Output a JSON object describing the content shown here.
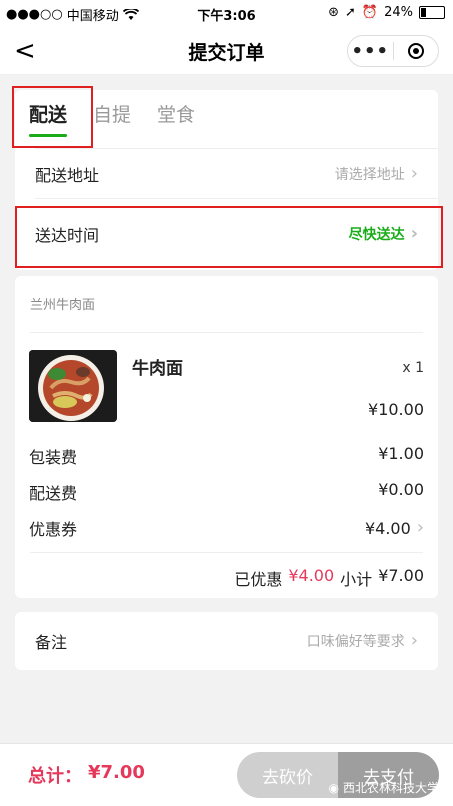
{
  "status_bar": {
    "signal": "●●●○○",
    "carrier": "中国移动",
    "wifi_icon": "wifi-icon",
    "time": "下午3:06",
    "battery": "24%",
    "battery_level": 0.24
  },
  "navbar": {
    "title": "提交订单",
    "more": "•••"
  },
  "tabs": [
    {
      "label": "配送",
      "active": true
    },
    {
      "label": "自提",
      "active": false
    },
    {
      "label": "堂食",
      "active": false
    }
  ],
  "address": {
    "label": "配送地址",
    "value": "请选择地址"
  },
  "delivery_time": {
    "label": "送达时间",
    "value": "尽快送达"
  },
  "order": {
    "shop": "兰州牛肉面",
    "item": {
      "name": "牛肉面",
      "qty": "x 1",
      "price": "¥10.00"
    },
    "packaging": {
      "label": "包装费",
      "amount": "¥1.00"
    },
    "delivery_fee": {
      "label": "配送费",
      "amount": "¥0.00"
    },
    "coupon": {
      "label": "优惠券",
      "amount": "¥4.00"
    },
    "summary": {
      "discount_label": "已优惠",
      "discount": "¥4.00",
      "subtotal_label": "小计",
      "subtotal": "¥7.00"
    }
  },
  "remark": {
    "label": "备注",
    "placeholder": "口味偏好等要求"
  },
  "footer": {
    "total_label": "总计：",
    "total": "¥7.00",
    "bargain_label": "去砍价",
    "pay_label": "去支付",
    "watermark": "西北农林科技大学"
  },
  "colors": {
    "accent_green": "#1aad19",
    "price_red": "#e5395c",
    "annotation_red": "#e02020"
  }
}
